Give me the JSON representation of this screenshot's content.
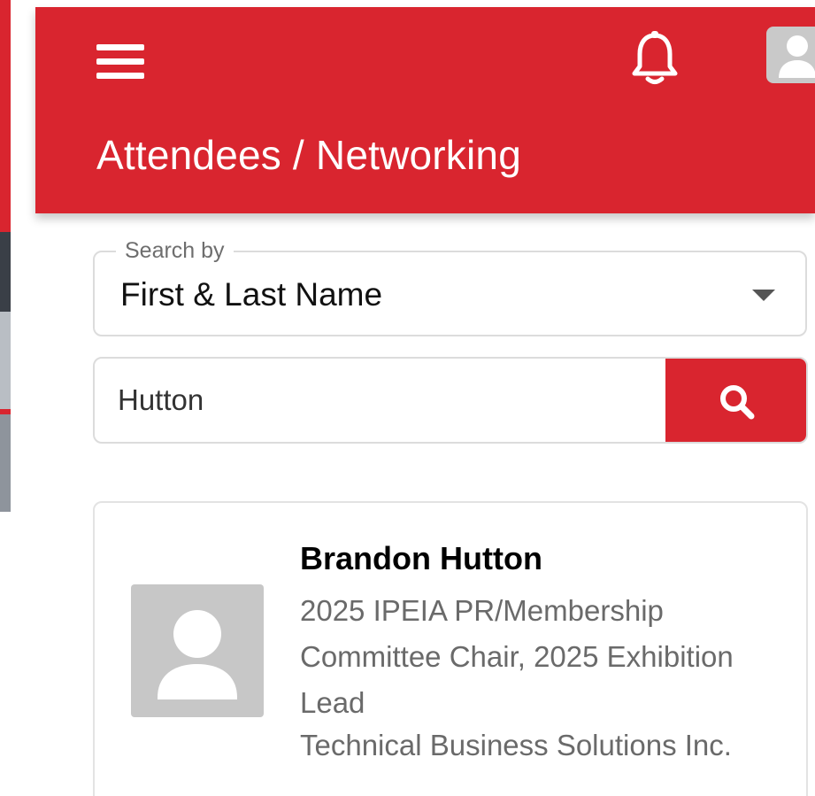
{
  "header": {
    "title": "Attendees / Networking",
    "menu_icon": "menu-icon",
    "notifications_icon": "bell-icon",
    "profile_icon": "user-icon",
    "background_color": "#d9252f"
  },
  "search": {
    "search_by_label": "Search by",
    "search_by_value": "First & Last Name",
    "query_value": "Hutton",
    "button_icon": "search-icon"
  },
  "results": [
    {
      "name": "Brandon Hutton",
      "role": "2025 IPEIA PR/Membership Committee Chair, 2025 Exhibition Lead",
      "company": "Technical Business Solutions Inc.",
      "avatar_icon": "user-icon"
    }
  ]
}
